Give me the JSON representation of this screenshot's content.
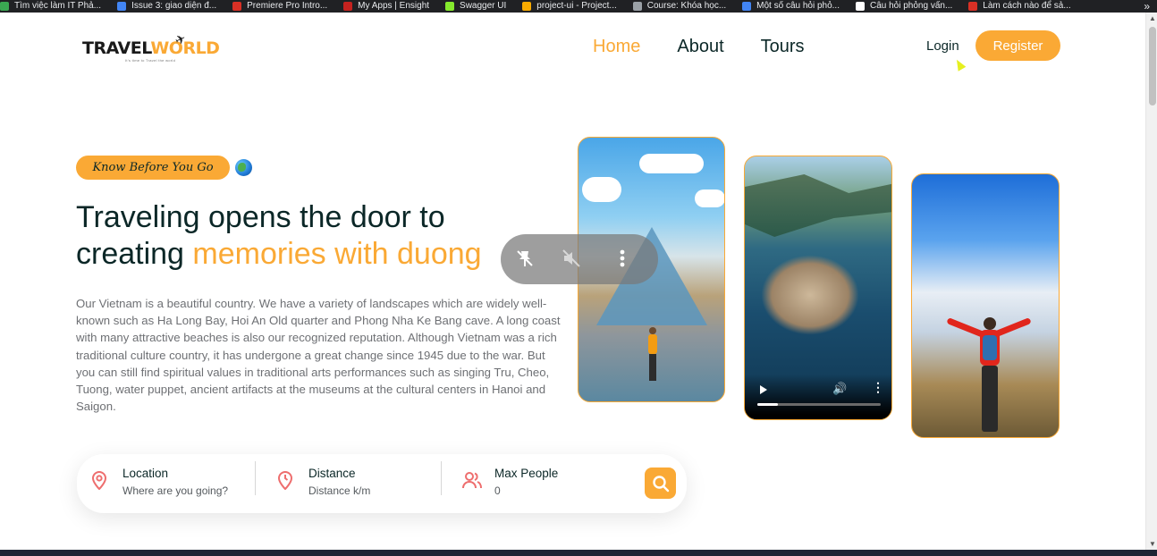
{
  "bookmarks": [
    {
      "label": "Tìm việc làm IT Phả...",
      "color": "#3aa852"
    },
    {
      "label": "Issue 3: giao diện đ...",
      "color": "#4285f4"
    },
    {
      "label": "Premiere Pro Intro...",
      "color": "#d93025"
    },
    {
      "label": "My Apps | Ensight",
      "color": "#c5221f"
    },
    {
      "label": "Swagger UI",
      "color": "#85ea2d"
    },
    {
      "label": "project-ui - Project...",
      "color": "#f9ab00"
    },
    {
      "label": "Course: Khóa học...",
      "color": "#9aa0a6"
    },
    {
      "label": "Một số câu hỏi phỏ...",
      "color": "#4285f4"
    },
    {
      "label": "Câu hỏi phỏng vấn...",
      "color": "#ffffff"
    },
    {
      "label": "Làm cách nào để sả...",
      "color": "#d93025"
    }
  ],
  "header": {
    "logo_part1": "TRAVEL",
    "logo_part2": "WORLD",
    "logo_tagline": "It's time to Travel the world",
    "nav": [
      "Home",
      "About",
      "Tours"
    ],
    "login_label": "Login",
    "register_label": "Register"
  },
  "hero": {
    "subtitle": "Know Before You Go",
    "headline_part1": "Traveling opens the door to",
    "headline_part2": "creating",
    "headline_highlight": "memories with duong",
    "description": "Our Vietnam is a beautiful country. We have a variety of landscapes which are widely well-known such as Ha Long Bay, Hoi An Old quarter and Phong Nha Ke Bang cave. A long coast with many attractive beaches is also our recognized reputation. Although Vietnam was a rich traditional culture country, it has undergone a great change since 1945 due to the war. But you can still find spiritual values in traditional arts performances such as singing Tru, Cheo, Tuong, water puppet, ancient artifacts at the museums at the cultural centers in Hanoi and Saigon."
  },
  "video": {
    "progress": 0.17
  },
  "search": {
    "location_label": "Location",
    "location_placeholder": "Where are you going?",
    "distance_label": "Distance",
    "distance_placeholder": "Distance k/m",
    "people_label": "Max People",
    "people_value": "0"
  },
  "colors": {
    "accent": "#faa935",
    "heading": "#0b2727",
    "icon_red": "#ee6e6e"
  }
}
